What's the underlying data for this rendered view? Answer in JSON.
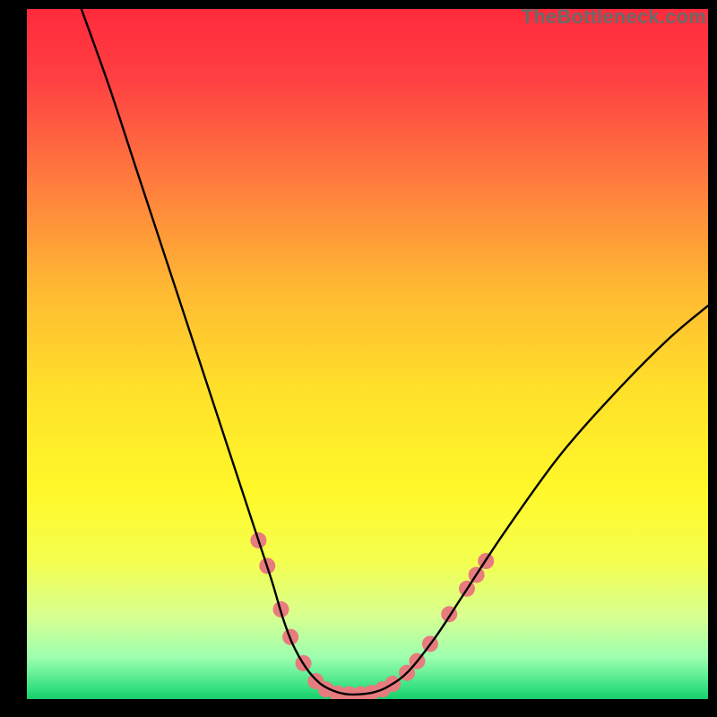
{
  "watermark": "TheBottleneck.com",
  "chart_data": {
    "type": "line",
    "title": "",
    "xlabel": "",
    "ylabel": "",
    "xlim": [
      0,
      100
    ],
    "ylim": [
      0,
      100
    ],
    "series": [
      {
        "name": "curve",
        "x": [
          8,
          12,
          16,
          20,
          24,
          28,
          32,
          34,
          36,
          37.5,
          39,
          41,
          43,
          45,
          47,
          49,
          51,
          53,
          56,
          60,
          64,
          70,
          78,
          86,
          94,
          100
        ],
        "y": [
          100,
          89,
          77,
          65,
          53,
          41,
          29,
          23,
          17,
          12,
          8,
          4.5,
          2.3,
          1.2,
          0.7,
          0.7,
          1.0,
          1.8,
          4,
          9,
          15,
          24,
          35,
          44,
          52,
          57
        ]
      }
    ],
    "markers": [
      {
        "x": 34.0,
        "y": 23.0
      },
      {
        "x": 35.3,
        "y": 19.3
      },
      {
        "x": 37.3,
        "y": 13.0
      },
      {
        "x": 38.7,
        "y": 9.0
      },
      {
        "x": 40.6,
        "y": 5.2
      },
      {
        "x": 42.4,
        "y": 2.6
      },
      {
        "x": 43.9,
        "y": 1.4
      },
      {
        "x": 45.6,
        "y": 0.8
      },
      {
        "x": 47.3,
        "y": 0.7
      },
      {
        "x": 49.0,
        "y": 0.7
      },
      {
        "x": 50.6,
        "y": 0.9
      },
      {
        "x": 52.2,
        "y": 1.4
      },
      {
        "x": 53.7,
        "y": 2.2
      },
      {
        "x": 55.8,
        "y": 3.8
      },
      {
        "x": 57.3,
        "y": 5.5
      },
      {
        "x": 59.2,
        "y": 8.0
      },
      {
        "x": 62.0,
        "y": 12.3
      },
      {
        "x": 64.6,
        "y": 16.0
      },
      {
        "x": 66.0,
        "y": 18.0
      },
      {
        "x": 67.4,
        "y": 20.0
      }
    ],
    "gradient_stops": [
      {
        "offset": 0.0,
        "color": "#ff2a3b"
      },
      {
        "offset": 0.1,
        "color": "#ff3f43"
      },
      {
        "offset": 0.25,
        "color": "#ff7c3e"
      },
      {
        "offset": 0.4,
        "color": "#ffb733"
      },
      {
        "offset": 0.55,
        "color": "#ffe02a"
      },
      {
        "offset": 0.7,
        "color": "#fff82a"
      },
      {
        "offset": 0.8,
        "color": "#f4ff4f"
      },
      {
        "offset": 0.88,
        "color": "#d8ff90"
      },
      {
        "offset": 0.94,
        "color": "#9cffb0"
      },
      {
        "offset": 0.985,
        "color": "#34e07f"
      },
      {
        "offset": 1.0,
        "color": "#16ce6b"
      }
    ],
    "marker_style": {
      "fill": "#e77b7d",
      "r": 9
    },
    "curve_style": {
      "stroke": "#000000",
      "width": 2.4
    }
  }
}
